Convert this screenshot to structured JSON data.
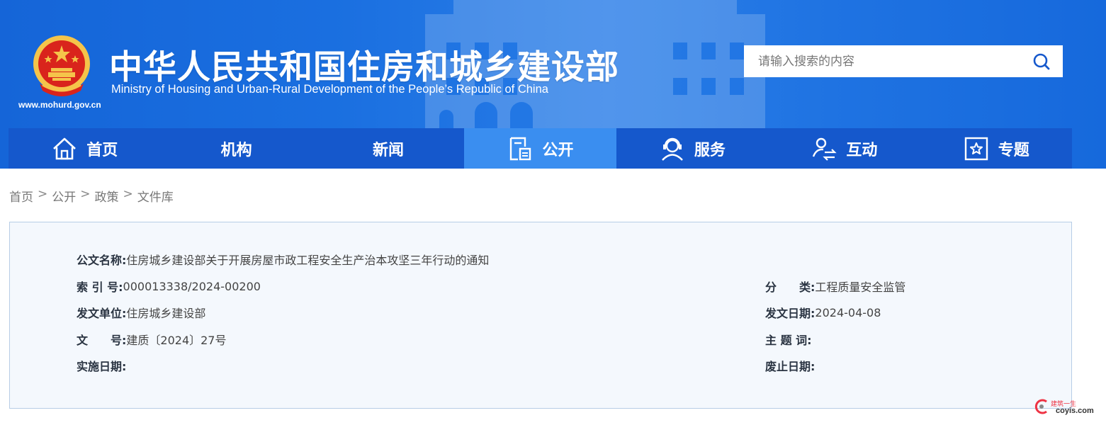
{
  "header": {
    "title_cn": "中华人民共和国住房和城乡建设部",
    "title_en": "Ministry of Housing and Urban-Rural Development of the People’s Republic of China",
    "site_url": "www.mohurd.gov.cn",
    "search": {
      "placeholder": "请输入搜索的内容"
    }
  },
  "nav": {
    "items": [
      {
        "label": "首页",
        "icon": "home-icon"
      },
      {
        "label": "机构",
        "icon": ""
      },
      {
        "label": "新闻",
        "icon": ""
      },
      {
        "label": "公开",
        "icon": "document-icon",
        "active": true
      },
      {
        "label": "服务",
        "icon": "support-agent-icon"
      },
      {
        "label": "互动",
        "icon": "interact-user-icon"
      },
      {
        "label": "专题",
        "icon": "star-frame-icon"
      }
    ]
  },
  "breadcrumb": {
    "items": [
      "首页",
      "公开",
      "政策",
      "文件库"
    ],
    "separator": ">"
  },
  "document": {
    "name_label": "公文名称:",
    "name": "住房城乡建设部关于开展房屋市政工程安全生产治本攻坚三年行动的通知",
    "index_label": "索 引 号:",
    "index": "000013338/2024-00200",
    "category_label": "分　　类:",
    "category": "工程质量安全监管",
    "issuer_label": "发文单位:",
    "issuer": "住房城乡建设部",
    "issue_date_label": "发文日期:",
    "issue_date": "2024-04-08",
    "doc_no_label": "文　　号:",
    "doc_no": "建质〔2024〕27号",
    "keywords_label": "主 题 词:",
    "keywords": "",
    "effective_label": "实施日期:",
    "effective": "",
    "expiry_label": "废止日期:",
    "expiry": ""
  },
  "watermark": {
    "line1": "建筑一生",
    "line2": "coyis.com"
  },
  "colors": {
    "header_blue": "#1a6fe0",
    "nav_blue": "#1558cc",
    "nav_active": "#3a8ef0",
    "card_bg": "#f4f8fd",
    "card_border": "#b7cde6"
  }
}
